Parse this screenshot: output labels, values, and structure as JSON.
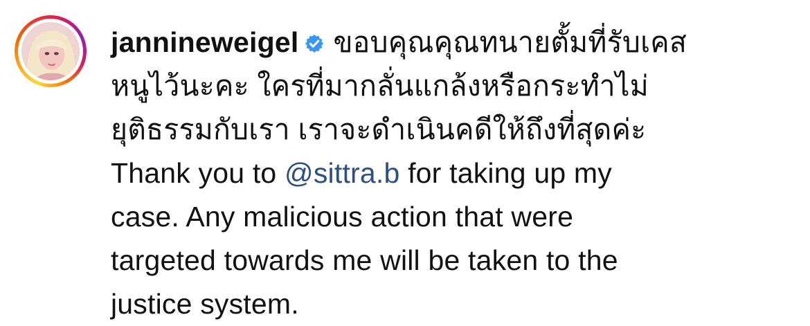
{
  "comment": {
    "username": "jannineweigel",
    "verified_icon": "verified-badge-icon",
    "thai_lines": [
      "ขอบคุณคุณทนายตั้มที่รับเคส",
      "หนูไว้นะคะ ใครที่มากลั่นแกล้งหรือกระทำไม่",
      "ยุติธรรมกับเรา เราจะดำเนินคดีให้ถึงที่สุดค่ะ"
    ],
    "english": {
      "prefix": "Thank you to ",
      "mention": "@sittra.b",
      "line1_suffix": " for taking up my",
      "line2": "case. Any malicious action that were",
      "line3": "targeted towards me will be taken to the",
      "line4": "justice system."
    }
  },
  "colors": {
    "mention": "#2d4f82",
    "verified": "#3897f0",
    "text": "#111111"
  }
}
